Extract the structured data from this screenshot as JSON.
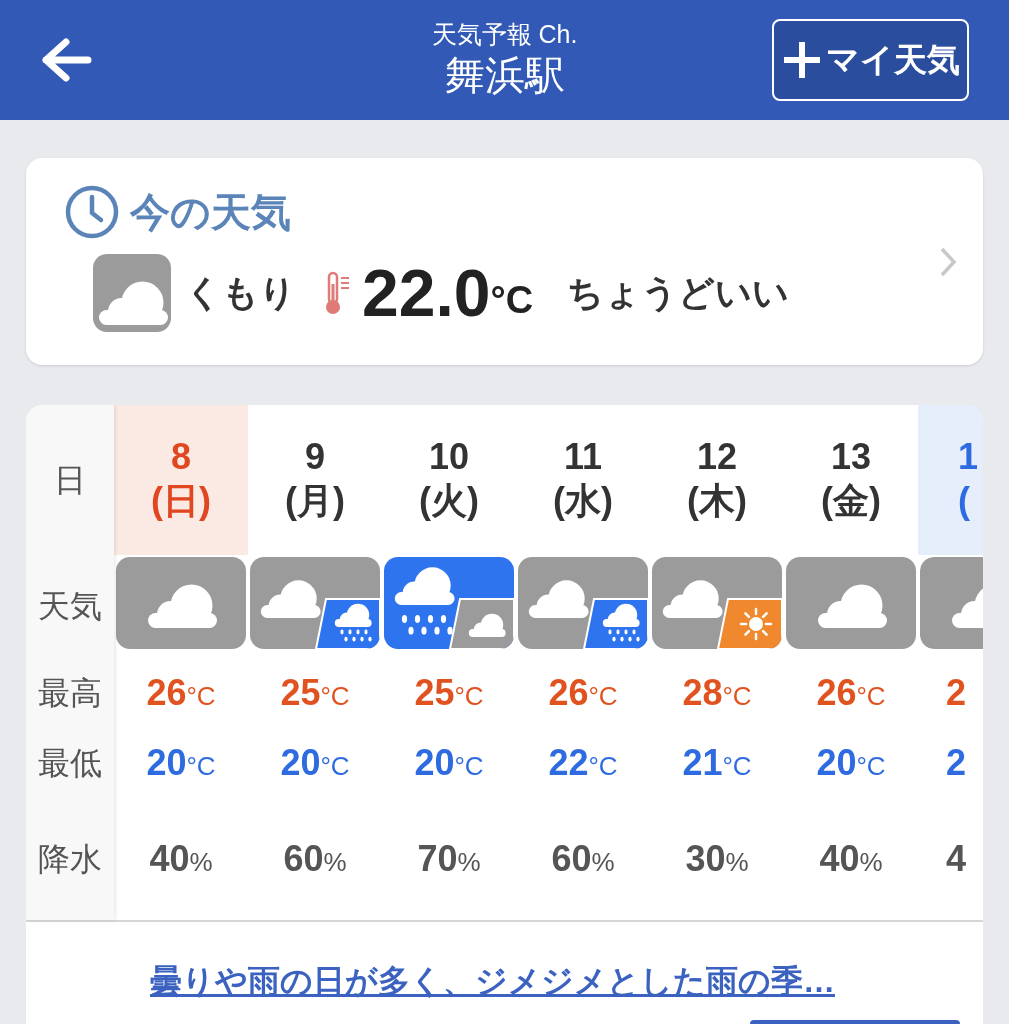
{
  "header": {
    "subtitle": "天気予報 Ch.",
    "title": "舞浜駅",
    "my_weather_button": "マイ天気"
  },
  "current": {
    "heading": "今の天気",
    "weather": {
      "kind": "cloudy"
    },
    "condition": "くもり",
    "temperature": "22.0",
    "unit": "°C",
    "feeling": "ちょうどいい"
  },
  "forecast": {
    "row_labels": [
      "日",
      "天気",
      "最高",
      "最低",
      "降水"
    ],
    "days": [
      {
        "date": "8",
        "weekday": "(日)",
        "color": "#e0461f",
        "highlighted": true,
        "cut_off": false,
        "weather": {
          "kind": "cloudy"
        },
        "high": "26",
        "high_unit": "°C",
        "low": "20",
        "low_unit": "°C",
        "rain": "40",
        "rain_unit": "%"
      },
      {
        "date": "9",
        "weekday": "(月)",
        "color": "#333333",
        "highlighted": false,
        "cut_off": false,
        "weather": {
          "kind": "cloudy_then_rain"
        },
        "high": "25",
        "high_unit": "°C",
        "low": "20",
        "low_unit": "°C",
        "rain": "60",
        "rain_unit": "%"
      },
      {
        "date": "10",
        "weekday": "(火)",
        "color": "#333333",
        "highlighted": false,
        "cut_off": false,
        "weather": {
          "kind": "rain_then_cloudy"
        },
        "high": "25",
        "high_unit": "°C",
        "low": "20",
        "low_unit": "°C",
        "rain": "70",
        "rain_unit": "%"
      },
      {
        "date": "11",
        "weekday": "(水)",
        "color": "#333333",
        "highlighted": false,
        "cut_off": false,
        "weather": {
          "kind": "cloudy_then_rain"
        },
        "high": "26",
        "high_unit": "°C",
        "low": "22",
        "low_unit": "°C",
        "rain": "60",
        "rain_unit": "%"
      },
      {
        "date": "12",
        "weekday": "(木)",
        "color": "#333333",
        "highlighted": false,
        "cut_off": false,
        "weather": {
          "kind": "cloudy_then_sunny"
        },
        "high": "28",
        "high_unit": "°C",
        "low": "21",
        "low_unit": "°C",
        "rain": "30",
        "rain_unit": "%"
      },
      {
        "date": "13",
        "weekday": "(金)",
        "color": "#333333",
        "highlighted": false,
        "cut_off": false,
        "weather": {
          "kind": "cloudy"
        },
        "high": "26",
        "high_unit": "°C",
        "low": "20",
        "low_unit": "°C",
        "rain": "40",
        "rain_unit": "%"
      },
      {
        "date": "1",
        "weekday": "(",
        "color": "#2f6be0",
        "highlighted": true,
        "cut_off": true,
        "weather": {
          "kind": "cloudy"
        },
        "high": "2",
        "low": "2",
        "rain": "4"
      }
    ]
  },
  "summary_link": "曇りや雨の日が多く、ジメジメとした雨の季…"
}
